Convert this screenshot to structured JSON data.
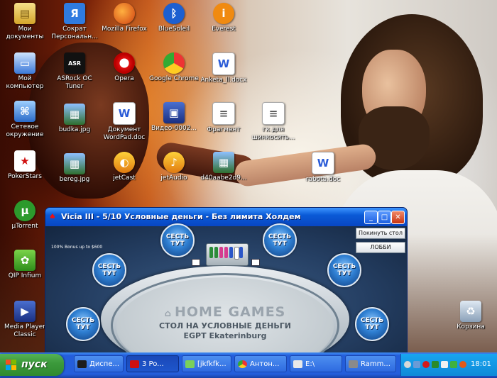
{
  "desktop": {
    "icons": [
      {
        "label": "Мои\nдокументы",
        "icon": "my-documents-icon"
      },
      {
        "label": "Мой\nкомпьютер",
        "icon": "my-computer-icon"
      },
      {
        "label": "Сетевое\nокружение",
        "icon": "network-icon"
      },
      {
        "label": "PokerStars",
        "icon": "pokerstars-icon"
      },
      {
        "label": "µTorrent",
        "icon": "utorrent-icon"
      },
      {
        "label": "QIP Infium",
        "icon": "qip-icon"
      },
      {
        "label": "Media Player\nClassic",
        "icon": "media-player-icon"
      },
      {
        "label": "Сократ\nПерсональн...",
        "icon": "sokrat-icon"
      },
      {
        "label": "ASRock OC\nTuner",
        "icon": "asrock-icon"
      },
      {
        "label": "budka.jpg",
        "icon": "image-file-icon"
      },
      {
        "label": "bereg.jpg",
        "icon": "image-file-icon"
      },
      {
        "label": "Mozilla Firefox",
        "icon": "firefox-icon"
      },
      {
        "label": "Opera",
        "icon": "opera-icon"
      },
      {
        "label": "Документ\nWordPad.doc",
        "icon": "word-document-icon"
      },
      {
        "label": "jetCast",
        "icon": "jetcast-icon"
      },
      {
        "label": "BlueSoleil",
        "icon": "bluetooth-icon"
      },
      {
        "label": "Google Chrome",
        "icon": "chrome-icon"
      },
      {
        "label": "Видео-0002...",
        "icon": "video-file-icon"
      },
      {
        "label": "jetAudio",
        "icon": "jetaudio-icon"
      },
      {
        "label": "Everest",
        "icon": "everest-icon"
      },
      {
        "label": "Anketa_ll.docx",
        "icon": "word-document-icon"
      },
      {
        "label": "Фрагмент",
        "icon": "scrap-file-icon"
      },
      {
        "label": "d40aabe2d9...",
        "icon": "image-file-icon"
      },
      {
        "label": "гк для\nшинкосить...",
        "icon": "text-file-icon"
      },
      {
        "label": "rabota.doc",
        "icon": "word-document-icon"
      },
      {
        "label": "Корзина",
        "icon": "recycle-bin-icon"
      }
    ]
  },
  "poker_window": {
    "title": "Vicia III - 5/10 Условные деньги - Без лимита Холдем",
    "buttons": {
      "leave": "Покинуть стол",
      "lobby": "ЛОББИ"
    },
    "bonus_text": "100% Bonus up to $600",
    "seat_label_line1": "СЕСТЬ",
    "seat_label_line2": "ТУТ",
    "brand": "HOME GAMES",
    "table_line1": "СТОЛ НА УСЛОВНЫЕ ДЕНЬГИ",
    "table_line2": "EGPT Ekaterinburg"
  },
  "taskbar": {
    "start_label": "пуск",
    "tasks": [
      {
        "label": "Диспе...",
        "icon": "task-manager-icon"
      },
      {
        "label": "3 Po...",
        "icon": "pokerstars-icon"
      },
      {
        "label": "[jkfkfk...",
        "icon": "notepad-icon"
      },
      {
        "label": "Антон...",
        "icon": "chrome-icon"
      },
      {
        "label": "E:\\",
        "icon": "folder-icon"
      },
      {
        "label": "Ramm...",
        "icon": "media-icon"
      }
    ],
    "clock": "18:01"
  },
  "colors": {
    "titlebar": "#0a5ad6",
    "taskbar": "#245edb",
    "start_button": "#3c9a3c",
    "seat_button": "#2f7fd2"
  }
}
